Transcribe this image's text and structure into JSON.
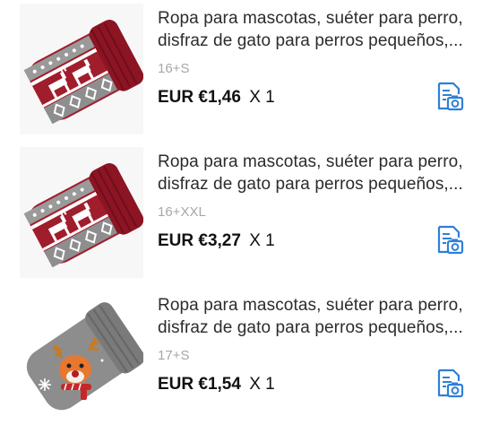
{
  "items": [
    {
      "title_line1": "Ropa para mascotas, suéter para perro,",
      "title_line2": "disfraz de gato para perros pequeños,...",
      "variant": "16+S",
      "price": "EUR €1,46",
      "quantity": "X 1",
      "image": "red-reindeer-sweater",
      "icon": "receipt-camera-icon"
    },
    {
      "title_line1": "Ropa para mascotas, suéter para perro,",
      "title_line2": "disfraz de gato para perros pequeños,...",
      "variant": "16+XXL",
      "price": "EUR €3,27",
      "quantity": "X 1",
      "image": "red-reindeer-sweater",
      "icon": "receipt-camera-icon"
    },
    {
      "title_line1": "Ropa para mascotas, suéter para perro,",
      "title_line2": "disfraz de gato para perros pequeños,...",
      "variant": "17+S",
      "price": "EUR €1,54",
      "quantity": "X 1",
      "image": "gray-reindeer-sweater",
      "icon": "receipt-camera-icon"
    }
  ],
  "colors": {
    "accent": "#2f7fd6",
    "sweater_red": "#9e1b2b",
    "sweater_gray": "#8d8d8d"
  }
}
